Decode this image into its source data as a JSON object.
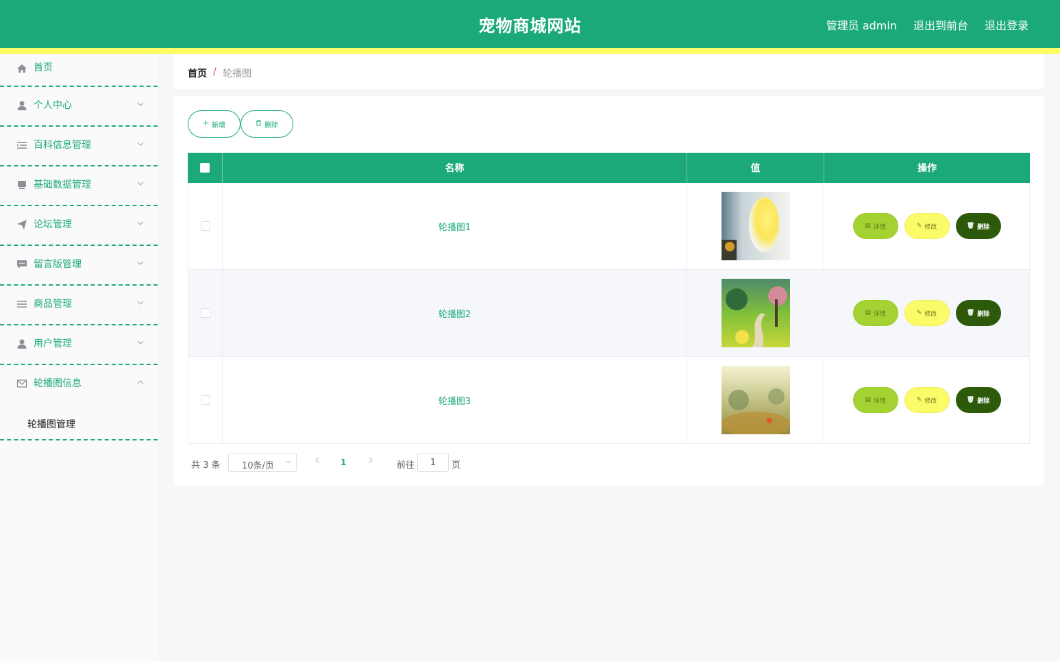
{
  "header": {
    "title": "宠物商城网站",
    "links": [
      "管理员 admin",
      "退出到前台",
      "退出登录"
    ]
  },
  "sidebar": {
    "items": [
      {
        "label": "首页",
        "icon": "home-icon"
      },
      {
        "label": "个人中心",
        "icon": "user-icon"
      },
      {
        "label": "百科信息管理",
        "icon": "list-icon"
      },
      {
        "label": "基础数据管理",
        "icon": "database-icon"
      },
      {
        "label": "论坛管理",
        "icon": "send-icon"
      },
      {
        "label": "留言版管理",
        "icon": "chat-icon"
      },
      {
        "label": "商品管理",
        "icon": "menu-icon"
      },
      {
        "label": "用户管理",
        "icon": "user-icon"
      },
      {
        "label": "轮播图信息",
        "icon": "mail-icon"
      }
    ],
    "submenu": "轮播图管理"
  },
  "breadcrumb": {
    "home": "首页",
    "separator": "/",
    "current": "轮播图"
  },
  "toolbar": {
    "add_label": "新增",
    "delete_label": "删除"
  },
  "table": {
    "headers": [
      "名称",
      "值",
      "操作"
    ],
    "rows": [
      {
        "name": "轮播图1"
      },
      {
        "name": "轮播图2"
      },
      {
        "name": "轮播图3"
      }
    ],
    "actions": {
      "detail": "详情",
      "edit": "修改",
      "delete": "删除"
    }
  },
  "pagination": {
    "total": "共 3 条",
    "page_size": "10条/页",
    "current_page": "1",
    "goto_label": "前往",
    "goto_value": "1",
    "page_suffix": "页"
  },
  "colors": {
    "primary": "#1ba97c",
    "stripe": "#fbfd66",
    "detail": "#a5d233",
    "edit": "#fbfb6a",
    "delete": "#2d5a0a"
  }
}
